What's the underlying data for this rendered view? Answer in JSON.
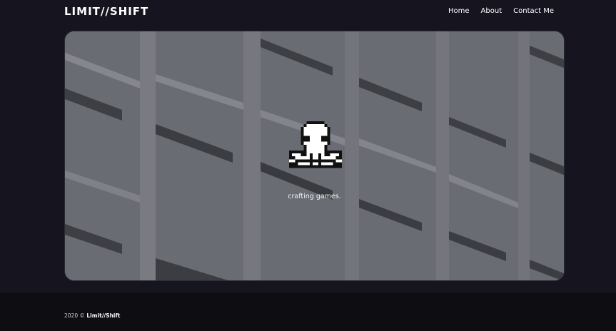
{
  "header": {
    "logo": "LIMIT//SHIFT",
    "nav": [
      "Home",
      "About",
      "Contact Me"
    ]
  },
  "hero": {
    "mascot_icon": "pixel-octopus-icon",
    "tagline": "crafting games."
  },
  "footer": {
    "year": "2020 ©",
    "brand": "Limit//Shift"
  },
  "colors": {
    "page_background": "#16151f",
    "footer_background": "#0e0e12",
    "text": "#ffffff"
  }
}
